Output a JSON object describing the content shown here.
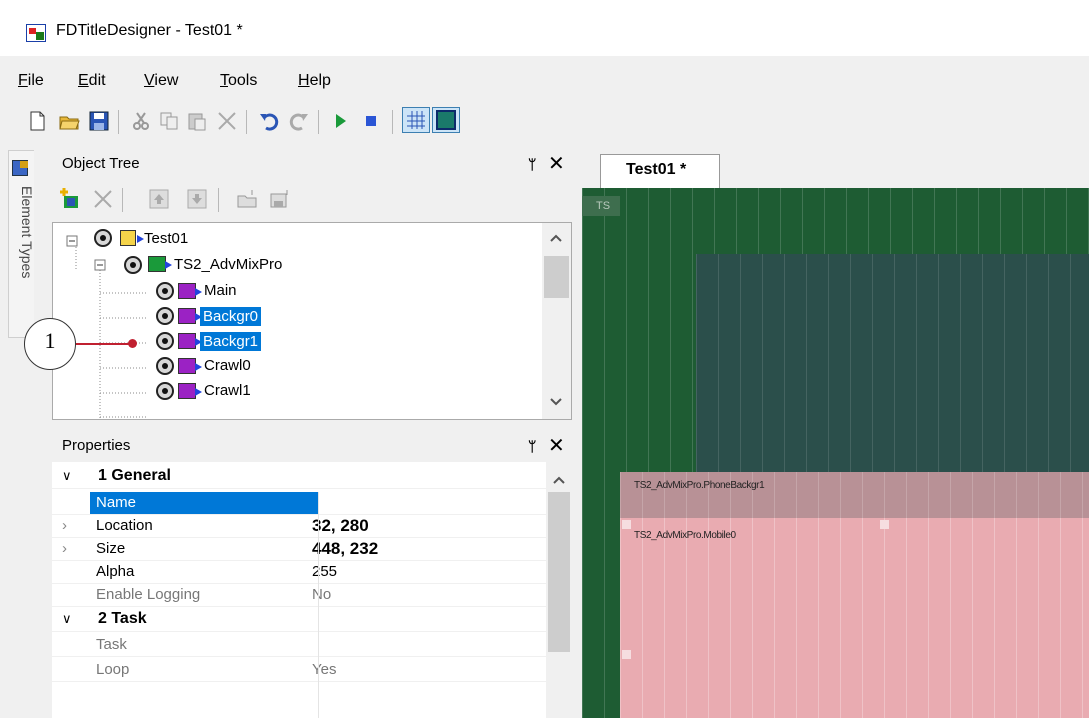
{
  "window": {
    "title": "FDTitleDesigner - Test01 *"
  },
  "menu": [
    {
      "pre": "",
      "key": "F",
      "rest": "ile"
    },
    {
      "pre": "",
      "key": "E",
      "rest": "dit"
    },
    {
      "pre": "",
      "key": "V",
      "rest": "iew"
    },
    {
      "pre": "",
      "key": "T",
      "rest": "ools"
    },
    {
      "pre": "",
      "key": "H",
      "rest": "elp"
    }
  ],
  "side_tab": {
    "label": "Element Types"
  },
  "object_tree": {
    "title": "Object Tree",
    "pin": "\u0004",
    "close": "✕",
    "items": [
      {
        "label": "Test01",
        "selected": false
      },
      {
        "label": "TS2_AdvMixPro",
        "selected": false
      },
      {
        "label": "Main",
        "selected": false
      },
      {
        "label": "Backgr0",
        "selected": true
      },
      {
        "label": "Backgr1",
        "selected": true
      },
      {
        "label": "Crawl0",
        "selected": false
      },
      {
        "label": "Crawl1",
        "selected": false
      }
    ]
  },
  "callout": {
    "number": "1"
  },
  "properties": {
    "title": "Properties",
    "categories": [
      {
        "label": "1 General",
        "rows": [
          {
            "name": "Name",
            "value": "",
            "selected": true
          },
          {
            "name": "Location",
            "value": "32, 280",
            "bold": true,
            "expand": true
          },
          {
            "name": "Size",
            "value": "448, 232",
            "bold": true,
            "expand": true
          },
          {
            "name": "Alpha",
            "value": "255"
          },
          {
            "name": "Enable Logging",
            "value": "No",
            "gray": true
          }
        ]
      },
      {
        "label": "2 Task",
        "rows": [
          {
            "name": "Task",
            "value": "",
            "gray": true
          },
          {
            "name": "Loop",
            "value": "Yes",
            "gray": true
          }
        ]
      }
    ]
  },
  "document": {
    "tab": "Test01 *",
    "ts_tag": "TS",
    "band_label": "TS2_AdvMixPro.PhoneBackgr1",
    "pink_label": "TS2_AdvMixPro.Mobile0"
  },
  "colors": {
    "selection": "#0078d7",
    "canvas": "#1e5c33",
    "slate": "#2b4f4b",
    "pink": "#e9abb1",
    "callout_line": "#c02030"
  }
}
